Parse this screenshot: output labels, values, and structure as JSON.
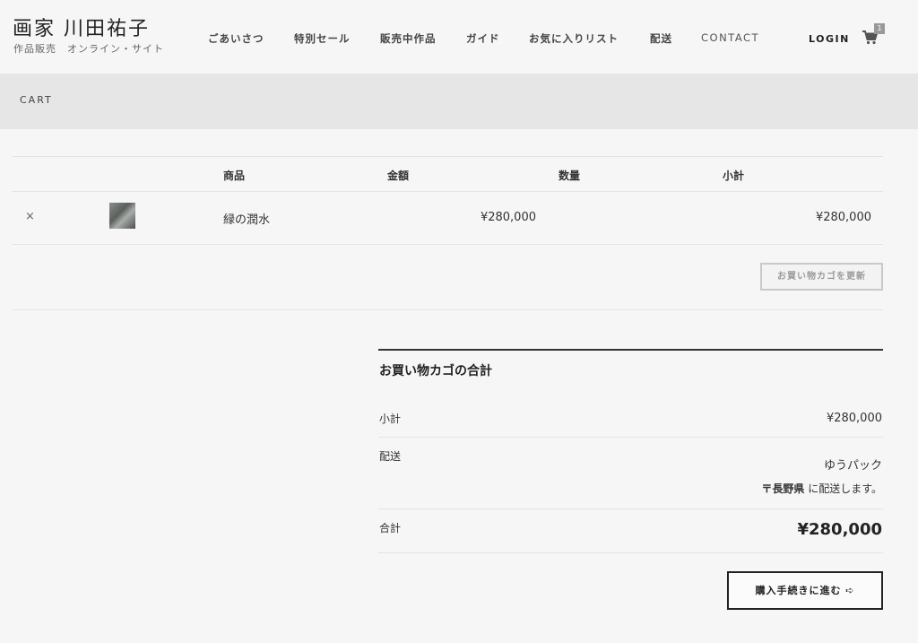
{
  "site": {
    "title": "画家 川田祐子",
    "subtitle": "作品販売　オンライン・サイト"
  },
  "nav": {
    "items": [
      {
        "label": "ごあいさつ"
      },
      {
        "label": "特別セール"
      },
      {
        "label": "販売中作品"
      },
      {
        "label": "ガイド"
      },
      {
        "label": "お気に入りリスト"
      },
      {
        "label": "配送"
      },
      {
        "label": "CONTACT"
      }
    ],
    "login_label": "LOGIN",
    "cart_count": "1",
    "cart_icon": "shopping-cart-icon"
  },
  "banner": {
    "title": "CART"
  },
  "cart": {
    "headers": {
      "product": "商品",
      "price": "金額",
      "quantity": "数量",
      "subtotal": "小計"
    },
    "items": [
      {
        "remove_label": "×",
        "thumbnail": "artwork-thumbnail",
        "name": "緑の潤水",
        "price": "¥280,000",
        "subtotal": "¥280,000"
      }
    ],
    "update_button": "お買い物カゴを更新"
  },
  "totals": {
    "title": "お買い物カゴの合計",
    "subtotal_label": "小計",
    "subtotal_value": "¥280,000",
    "shipping_label": "配送",
    "shipping_method": "ゆうパック",
    "shipping_destination_pref": "〒長野県",
    "shipping_destination_suffix": " に配送します。",
    "total_label": "合計",
    "total_value": "¥280,000",
    "checkout_button": "購入手続きに進む ➪"
  },
  "colors": {
    "background": "#f6f6f6",
    "banner": "#e6e6e6",
    "text": "#333333",
    "badge": "#999999"
  }
}
